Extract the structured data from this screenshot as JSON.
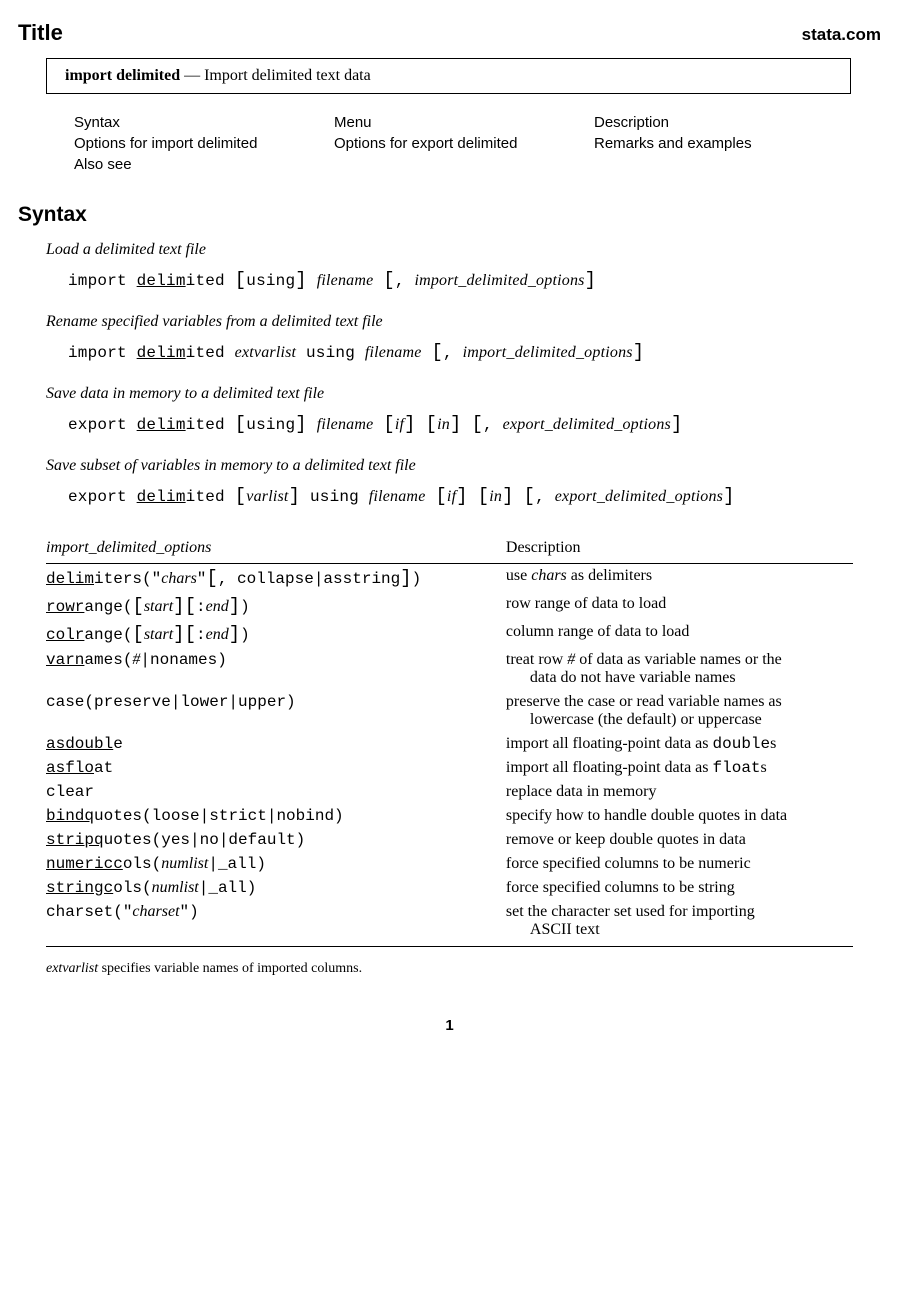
{
  "header": {
    "title_label": "Title",
    "brand": "stata.com",
    "cmd_name": "import delimited",
    "cmd_sep": " — ",
    "cmd_desc": "Import delimited text data"
  },
  "nav": {
    "r1c1": "Syntax",
    "r1c2": "Menu",
    "r1c3": "Description",
    "r2c1": "Options for import delimited",
    "r2c2": "Options for export delimited",
    "r2c3": "Remarks and examples",
    "r3c1": "Also see"
  },
  "syntax_heading": "Syntax",
  "syn1": {
    "desc": "Load a delimited text file",
    "p1": "import ",
    "u1": "delim",
    "p2": "ited ",
    "br1": "[",
    "p3": "using",
    "br2": "]",
    "sp": " ",
    "it1": "filename",
    "sp2": " ",
    "br3": "[",
    "p4": ", ",
    "it2": "import_delimited_options",
    "br4": "]"
  },
  "syn2": {
    "desc": "Rename specified variables from a delimited text file",
    "p1": "import ",
    "u1": "delim",
    "p2": "ited ",
    "it1": "extvarlist",
    "p3": " using ",
    "it2": "filename",
    "sp": " ",
    "br1": "[",
    "p4": ", ",
    "it3": "import_delimited_options",
    "br2": "]"
  },
  "syn3": {
    "desc": "Save data in memory to a delimited text file",
    "p1": "export ",
    "u1": "delim",
    "p2": "ited ",
    "br1": "[",
    "p3": "using",
    "br2": "]",
    "sp": " ",
    "it1": "filename",
    "sp2": " ",
    "br3": "[",
    "it2": "if",
    "br4": "]",
    "sp3": " ",
    "br5": "[",
    "it3": "in",
    "br6": "]",
    "sp4": "  ",
    "br7": "[",
    "p4": ", ",
    "it4": "export_delimited_options",
    "br8": "]"
  },
  "syn4": {
    "desc": "Save subset of variables in memory to a delimited text file",
    "p1": "export ",
    "u1": "delim",
    "p2": "ited ",
    "br1": "[",
    "it1": "varlist",
    "br2": "]",
    "p3": " using ",
    "it2": "filename",
    "sp": " ",
    "br3": "[",
    "it3": "if",
    "br4": "]",
    "sp2": " ",
    "br5": "[",
    "it4": "in",
    "br6": "]",
    "sp3": "  ",
    "br7": "[",
    "p4": ", ",
    "it5": "export_delimited_options",
    "br8": "]"
  },
  "opts_header": {
    "col1": "import_delimited_options",
    "col2": "Description"
  },
  "rows": [
    {
      "opt_html": "<span class='u'>delim</span>iters(\"<span class='it'>chars</span>\"<span class='br'>[</span>, collapse|asstring<span class='br'>]</span>)",
      "desc_html": "use <span class='it'>chars</span> as delimiters"
    },
    {
      "opt_html": "<span class='u'>rowr</span>ange(<span class='br'>[</span><span class='it'>start</span><span class='br'>]</span><span class='br'>[</span>:<span class='it'>end</span><span class='br'>]</span>)",
      "desc_html": "row range of data to load"
    },
    {
      "opt_html": "<span class='u'>colr</span>ange(<span class='br'>[</span><span class='it'>start</span><span class='br'>]</span><span class='br'>[</span>:<span class='it'>end</span><span class='br'>]</span>)",
      "desc_html": "column range of data to load"
    },
    {
      "opt_html": "<span class='u'>varn</span>ames(<span class='it'>#</span>|nonames)",
      "desc_html": "treat row <span class='it'>#</span> of data as variable names or the<span class='desc-indent'>data do not have variable names</span>"
    },
    {
      "opt_html": "case(preserve|lower|upper)",
      "desc_html": "preserve the case or read variable names as<span class='desc-indent'>lowercase (the default) or uppercase</span>"
    },
    {
      "opt_html": "<span class='u'>asdoubl</span>e",
      "desc_html": "import all floating-point data as <span class='tt'>double</span>s"
    },
    {
      "opt_html": "<span class='u'>asflo</span>at",
      "desc_html": "import all floating-point data as <span class='tt'>float</span>s"
    },
    {
      "opt_html": "clear",
      "desc_html": "replace data in memory"
    },
    {
      "opt_html": "<span class='u'>bindq</span>uotes(loose|strict|nobind)",
      "desc_html": "specify how to handle double quotes in data"
    },
    {
      "opt_html": "<span class='u'>stripq</span>uotes(yes|no|default)",
      "desc_html": "remove or keep double quotes in data"
    },
    {
      "opt_html": "<span class='u'>numericc</span>ols(<span class='it'>numlist</span>|_all)",
      "desc_html": "force specified columns to be numeric"
    },
    {
      "opt_html": "<span class='u'>stringc</span>ols(<span class='it'>numlist</span>|_all)",
      "desc_html": "force specified columns to be string"
    },
    {
      "opt_html": "charset(\"<span class='it'>charset</span>\")",
      "desc_html": "set the character set used for importing<span class='desc-indent'>ASCII text</span>"
    }
  ],
  "footnote": {
    "it": "extvarlist",
    "rest": " specifies variable names of imported columns."
  },
  "pagenum": "1"
}
